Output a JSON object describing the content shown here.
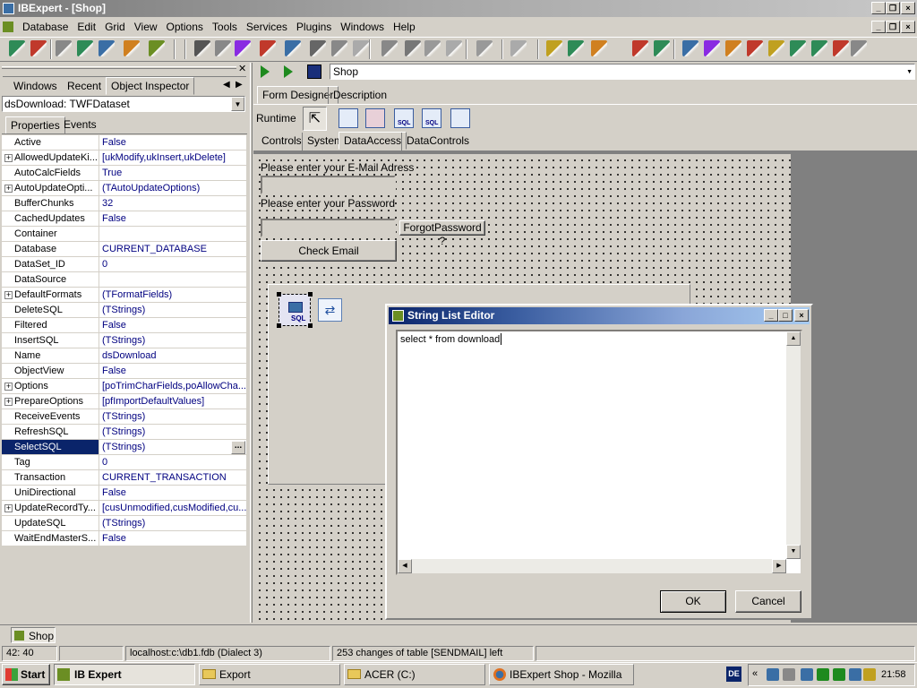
{
  "app": {
    "title": "IBExpert - [Shop]"
  },
  "menu": [
    "Database",
    "Edit",
    "Grid",
    "View",
    "Options",
    "Tools",
    "Services",
    "Plugins",
    "Windows",
    "Help"
  ],
  "inspector": {
    "tabs": [
      "Windows",
      "Recent",
      "Object Inspector"
    ],
    "object": "dsDownload: TWFDataset",
    "subtabs": [
      "Properties",
      "Events"
    ],
    "properties": [
      {
        "name": "Active",
        "value": "False",
        "expandable": false
      },
      {
        "name": "AllowedUpdateKi...",
        "value": "[ukModify,ukInsert,ukDelete]",
        "expandable": true
      },
      {
        "name": "AutoCalcFields",
        "value": "True",
        "expandable": false
      },
      {
        "name": "AutoUpdateOpti...",
        "value": "(TAutoUpdateOptions)",
        "expandable": true
      },
      {
        "name": "BufferChunks",
        "value": "32",
        "expandable": false
      },
      {
        "name": "CachedUpdates",
        "value": "False",
        "expandable": false
      },
      {
        "name": "Container",
        "value": "",
        "expandable": false
      },
      {
        "name": "Database",
        "value": "CURRENT_DATABASE",
        "expandable": false
      },
      {
        "name": "DataSet_ID",
        "value": "0",
        "expandable": false
      },
      {
        "name": "DataSource",
        "value": "",
        "expandable": false
      },
      {
        "name": "DefaultFormats",
        "value": "(TFormatFields)",
        "expandable": true
      },
      {
        "name": "DeleteSQL",
        "value": "(TStrings)",
        "expandable": false
      },
      {
        "name": "Filtered",
        "value": "False",
        "expandable": false
      },
      {
        "name": "InsertSQL",
        "value": "(TStrings)",
        "expandable": false
      },
      {
        "name": "Name",
        "value": "dsDownload",
        "expandable": false
      },
      {
        "name": "ObjectView",
        "value": "False",
        "expandable": false
      },
      {
        "name": "Options",
        "value": "[poTrimCharFields,poAllowCha...",
        "expandable": true
      },
      {
        "name": "PrepareOptions",
        "value": "[pfImportDefaultValues]",
        "expandable": true
      },
      {
        "name": "ReceiveEvents",
        "value": "(TStrings)",
        "expandable": false
      },
      {
        "name": "RefreshSQL",
        "value": "(TStrings)",
        "expandable": false
      },
      {
        "name": "SelectSQL",
        "value": "(TStrings)",
        "expandable": false,
        "selected": true
      },
      {
        "name": "Tag",
        "value": "0",
        "expandable": false
      },
      {
        "name": "Transaction",
        "value": "CURRENT_TRANSACTION",
        "expandable": false
      },
      {
        "name": "UniDirectional",
        "value": "False",
        "expandable": false
      },
      {
        "name": "UpdateRecordTy...",
        "value": "[cusUnmodified,cusModified,cu...",
        "expandable": true
      },
      {
        "name": "UpdateSQL",
        "value": "(TStrings)",
        "expandable": false
      },
      {
        "name": "WaitEndMasterS...",
        "value": "False",
        "expandable": false
      }
    ],
    "ellipsis": "..."
  },
  "designer": {
    "address": "Shop",
    "tabs": [
      "Form Designer",
      "Description"
    ],
    "runtime_label": "Runtime",
    "palette_tabs": [
      "Controls",
      "System",
      "DataAccess",
      "DataControls"
    ],
    "email_label": "Please enter your E-Mail Adress",
    "password_label": "Please enter your Password",
    "forgot_button": "ForgotPassword ?",
    "check_button": "Check Email",
    "sql_glyph": "SQL"
  },
  "dialog": {
    "title": "String List Editor",
    "content": "select * from download",
    "ok": "OK",
    "cancel": "Cancel"
  },
  "window_tab": "Shop",
  "status": {
    "position": "42:   40",
    "db": "localhost:c:\\db1.fdb (Dialect 3)",
    "changes": "253 changes of table [SENDMAIL] left"
  },
  "taskbar": {
    "start": "Start",
    "items": [
      "IB Expert",
      "Export",
      "ACER (C:)",
      "IBExpert Shop - Mozilla F..."
    ],
    "lang": "DE",
    "clock": "21:58"
  },
  "colors": {
    "selection": "#0a246a",
    "value_text": "#000080",
    "face": "#d4d0c8"
  }
}
